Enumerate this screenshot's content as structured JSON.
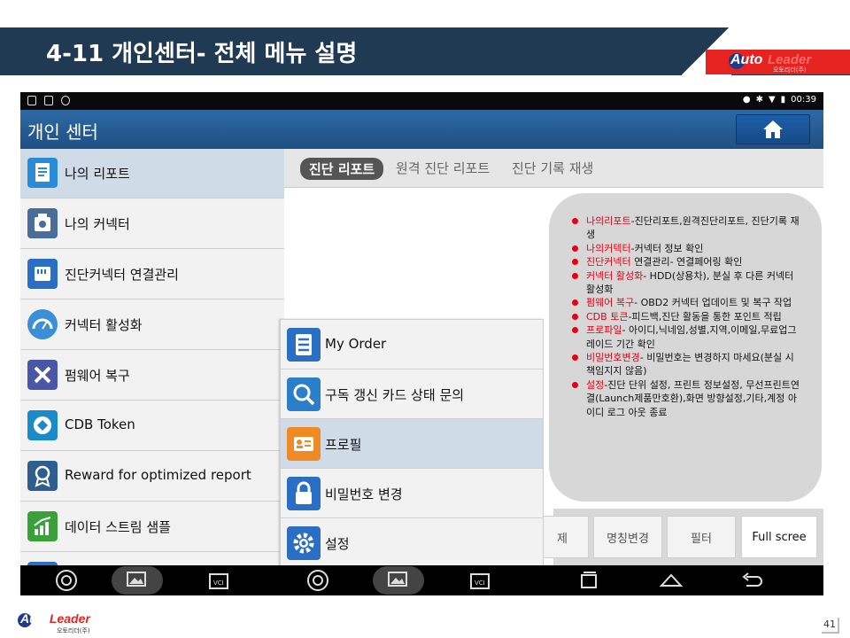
{
  "slide": {
    "title": "4-11 개인센터- 전체 메뉴 설명",
    "logo_auto": "Auto",
    "logo_leader": "Leader",
    "logo_sub": "오토리더(주)",
    "page_number": "41"
  },
  "statusbar": {
    "time": "00:39"
  },
  "app": {
    "title": "개인 센터",
    "home_icon": "home-icon"
  },
  "left_menu": [
    {
      "label": "나의 리포트",
      "icon": "report-icon",
      "color": "#2a8bd8"
    },
    {
      "label": "나의 커넥터",
      "icon": "connector-icon",
      "color": "#4a6e9a"
    },
    {
      "label": "진단커넥터 연결관리",
      "icon": "sd-card-icon",
      "color": "#2a6fc4"
    },
    {
      "label": "커넥터 활성화",
      "icon": "gauge-icon",
      "color": "#3a8fd6"
    },
    {
      "label": "펌웨어 복구",
      "icon": "tools-icon",
      "color": "#4a56a6"
    },
    {
      "label": "CDB Token",
      "icon": "token-icon",
      "color": "#1a8ac8"
    },
    {
      "label": "Reward for optimized report",
      "icon": "award-icon",
      "color": "#2e5e8e"
    },
    {
      "label": "데이터 스트림 샘플",
      "icon": "chart-icon",
      "color": "#3aa03a"
    }
  ],
  "tabs": [
    "진단 리포트",
    "원격 진단 리포트",
    "진단 기록 재생"
  ],
  "bottom_buttons": [
    "제",
    "명칭변경",
    "필터",
    "Full scree"
  ],
  "popup_menu": [
    {
      "label": "My Order",
      "icon": "order-icon",
      "color": "#2a6fc4"
    },
    {
      "label": "구독 갱신 카드 상태 문의",
      "icon": "search-icon",
      "color": "#2a7fc8"
    },
    {
      "label": "프로필",
      "icon": "profile-icon",
      "color": "#f08a24"
    },
    {
      "label": "비밀번호 변경",
      "icon": "lock-icon",
      "color": "#2a6fc4"
    },
    {
      "label": "설정",
      "icon": "gear-icon",
      "color": "#2a6fc4"
    }
  ],
  "callout": [
    {
      "term": "나의리포트",
      "desc": "-진단리포트,원격진단리포트, 진단기록 재생"
    },
    {
      "term": "나의커텍터",
      "desc": "-커넥터 정보 확인"
    },
    {
      "term": "진단커넥터",
      "desc": " 연결관리- 연결페어링 확인"
    },
    {
      "term": "커넥터 활성화",
      "desc": "- HDD(상용차), 분실 후 다른 커넥터 활성화"
    },
    {
      "term": "펌웨어 복구",
      "desc": "- OBD2 커넥터 업데이트 및 복구 작업"
    },
    {
      "term": "CDB 토큰",
      "desc": "-피드백,진단 활동을 통한 포인트 적립"
    },
    {
      "term": "프로파일",
      "desc": "- 아이디,닉네임,성별,지역,이메일,무료업그레이드 기간 확인"
    },
    {
      "term": "비밀번호변경",
      "desc": "- 비밀번호는 변경하지 마세요(분실 시 책임지지 않음)"
    },
    {
      "term": "설정",
      "desc": "-진단 단위 설정, 프린트 정보설정, 무선프린트연결(Launch제품만호환),화면 방향설정,기타,계정 아이디 로그 아웃 종료"
    }
  ],
  "colors": {
    "header": "#1f3a52",
    "accent_red": "#e60012",
    "appbar": "#1e4f82"
  }
}
